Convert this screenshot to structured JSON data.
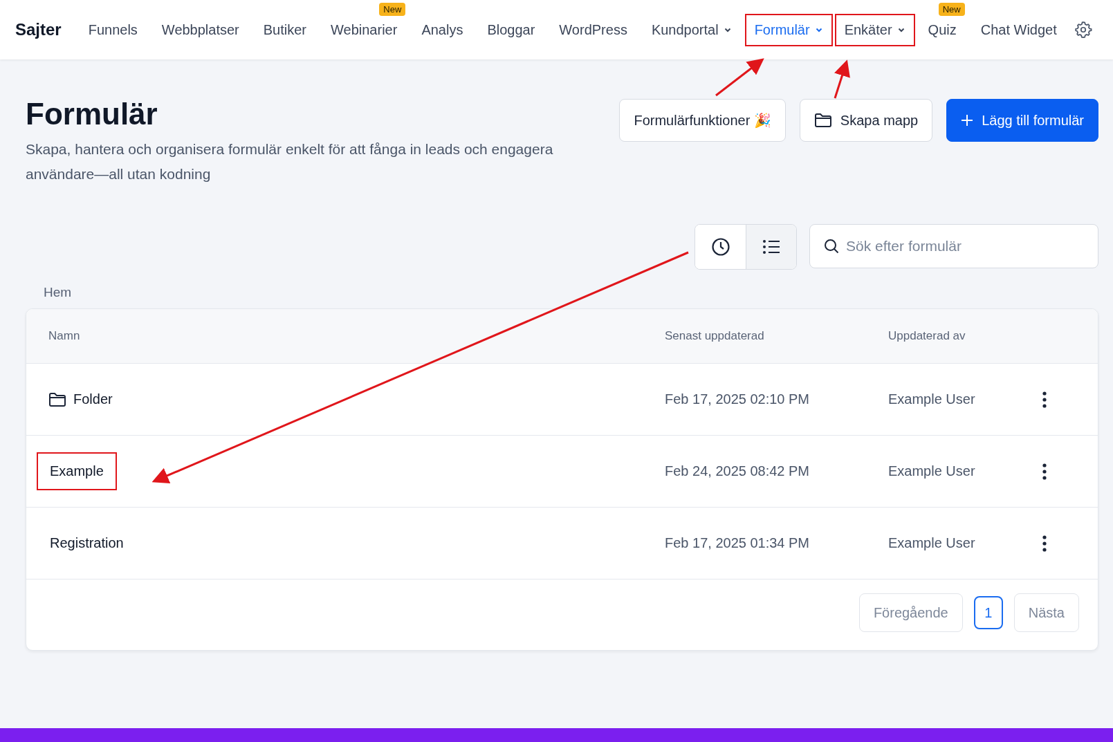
{
  "nav": {
    "brand": "Sajter",
    "items": [
      {
        "label": "Funnels",
        "selected": false,
        "dropdown": false,
        "highlighted": false
      },
      {
        "label": "Webbplatser",
        "selected": false,
        "dropdown": false,
        "highlighted": false
      },
      {
        "label": "Butiker",
        "selected": false,
        "dropdown": false,
        "highlighted": false
      },
      {
        "label": "Webinarier",
        "selected": false,
        "dropdown": false,
        "highlighted": false,
        "badge": "New"
      },
      {
        "label": "Analys",
        "selected": false,
        "dropdown": false,
        "highlighted": false
      },
      {
        "label": "Bloggar",
        "selected": false,
        "dropdown": false,
        "highlighted": false
      },
      {
        "label": "WordPress",
        "selected": false,
        "dropdown": false,
        "highlighted": false
      },
      {
        "label": "Kundportal",
        "selected": false,
        "dropdown": true,
        "highlighted": false
      },
      {
        "label": "Formulär",
        "selected": true,
        "dropdown": true,
        "highlighted": true
      },
      {
        "label": "Enkäter",
        "selected": false,
        "dropdown": true,
        "highlighted": true
      },
      {
        "label": "Quiz",
        "selected": false,
        "dropdown": false,
        "highlighted": false,
        "badge": "New"
      },
      {
        "label": "Chat Widget",
        "selected": false,
        "dropdown": false,
        "highlighted": false
      }
    ]
  },
  "header": {
    "title": "Formulär",
    "subtitle": "Skapa, hantera och organisera formulär enkelt för att fånga in leads och engagera användare—all utan kodning"
  },
  "actions": [
    {
      "label": "Formulärfunktioner 🎉",
      "kind": "secondary"
    },
    {
      "label": "Skapa mapp",
      "kind": "folder"
    },
    {
      "label": "Lägg till formulär",
      "kind": "primary"
    }
  ],
  "view_toggle": [
    {
      "kind": "recent",
      "selected": false
    },
    {
      "kind": "list",
      "selected": true
    }
  ],
  "search": {
    "placeholder": "Sök efter formulär"
  },
  "breadcrumb": "Hem",
  "table": {
    "columns": [
      "Namn",
      "Senast uppdaterad",
      "Uppdaterad av"
    ],
    "rows": [
      {
        "kind": "folder",
        "name": "Folder",
        "updated": "Feb 17, 2025 02:10 PM",
        "by": "Example User",
        "highlighted": false
      },
      {
        "kind": "form",
        "name": "Example",
        "updated": "Feb 24, 2025 08:42 PM",
        "by": "Example User",
        "highlighted": true
      },
      {
        "kind": "form",
        "name": "Registration",
        "updated": "Feb 17, 2025 01:34 PM",
        "by": "Example User",
        "highlighted": false
      }
    ]
  },
  "pagination": {
    "previous": "Föregående",
    "pages": [
      {
        "label": "1",
        "selected": true
      }
    ],
    "next": "Nästa"
  }
}
